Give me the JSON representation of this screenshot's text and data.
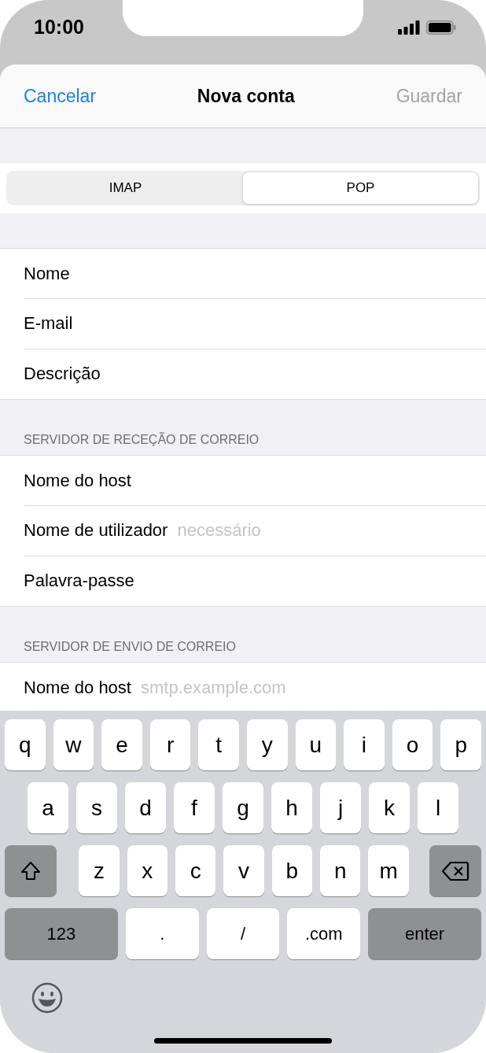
{
  "status_bar": {
    "time": "10:00"
  },
  "nav": {
    "cancel": "Cancelar",
    "title": "Nova conta",
    "save": {
      "label": "Guardar",
      "disabled": true
    }
  },
  "segments": [
    {
      "label": "IMAP",
      "selected": false
    },
    {
      "label": "POP",
      "selected": true
    }
  ],
  "sections": [
    {
      "rows": [
        {
          "label": "Nome"
        },
        {
          "label": "E-mail"
        },
        {
          "label": "Descrição"
        }
      ]
    },
    {
      "header": "SERVIDOR DE RECEÇÃO DE CORREIO",
      "rows": [
        {
          "label": "Nome do host"
        },
        {
          "label": "Nome de utilizador",
          "placeholder": "necessário"
        },
        {
          "label": "Palavra-passe"
        }
      ]
    },
    {
      "header": "SERVIDOR DE ENVIO DE CORREIO",
      "rows": [
        {
          "label": "Nome do host",
          "placeholder": "smtp.example.com"
        }
      ]
    }
  ],
  "keyboard": {
    "rows": [
      {
        "keys": [
          {
            "kind": "letter",
            "label": "q"
          },
          {
            "kind": "letter",
            "label": "w"
          },
          {
            "kind": "letter",
            "label": "e"
          },
          {
            "kind": "letter",
            "label": "r"
          },
          {
            "kind": "letter",
            "label": "t"
          },
          {
            "kind": "letter",
            "label": "y"
          },
          {
            "kind": "letter",
            "label": "u"
          },
          {
            "kind": "letter",
            "label": "i"
          },
          {
            "kind": "letter",
            "label": "o"
          },
          {
            "kind": "letter",
            "label": "p"
          }
        ]
      },
      {
        "keys": [
          {
            "kind": "letter",
            "label": "a"
          },
          {
            "kind": "letter",
            "label": "s"
          },
          {
            "kind": "letter",
            "label": "d"
          },
          {
            "kind": "letter",
            "label": "f"
          },
          {
            "kind": "letter",
            "label": "g"
          },
          {
            "kind": "letter",
            "label": "h"
          },
          {
            "kind": "letter",
            "label": "j"
          },
          {
            "kind": "letter",
            "label": "k"
          },
          {
            "kind": "letter",
            "label": "l"
          }
        ]
      },
      {
        "keys": [
          {
            "kind": "shift"
          },
          {
            "kind": "letter",
            "label": "z"
          },
          {
            "kind": "letter",
            "label": "x"
          },
          {
            "kind": "letter",
            "label": "c"
          },
          {
            "kind": "letter",
            "label": "v"
          },
          {
            "kind": "letter",
            "label": "b"
          },
          {
            "kind": "letter",
            "label": "n"
          },
          {
            "kind": "letter",
            "label": "m"
          },
          {
            "kind": "delete"
          }
        ]
      },
      {
        "keys": [
          {
            "kind": "function",
            "label": "123"
          },
          {
            "kind": "wide",
            "label": "."
          },
          {
            "kind": "wide",
            "label": "/"
          },
          {
            "kind": "wide",
            "label": ".com"
          },
          {
            "kind": "function",
            "label": "enter"
          }
        ]
      }
    ]
  }
}
